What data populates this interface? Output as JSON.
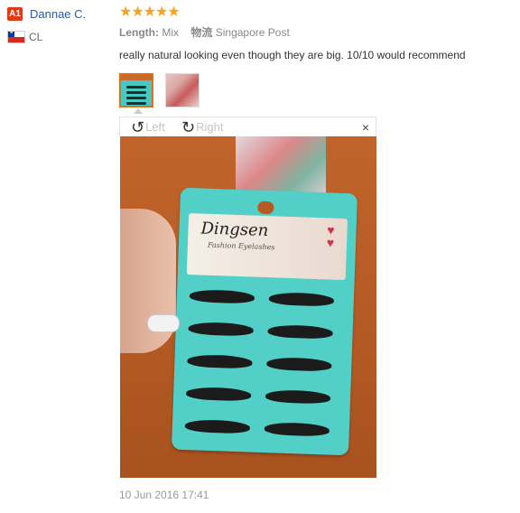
{
  "reviewer": {
    "badge": "A1",
    "name": "Dannae C.",
    "country_code": "CL"
  },
  "rating": {
    "stars": "★★★★★",
    "value": 5,
    "max": 5
  },
  "attributes": {
    "length_label": "Length:",
    "length_value": "Mix",
    "shipping_label": "物流",
    "shipping_value": "Singapore Post"
  },
  "review_text": "really natural looking even though they are big. 10/10 would recommend",
  "viewer": {
    "rotate_left": "Left",
    "rotate_right": "Right",
    "close": "×"
  },
  "photo": {
    "brand": "Dingsen",
    "subbrand": "Fashion Eyelashes"
  },
  "date": "10 Jun 2016 17:41",
  "colors": {
    "badge": "#e03b17",
    "username": "#2159b8",
    "stars": "#f5a41b",
    "active_thumb_border": "#e96b14"
  }
}
